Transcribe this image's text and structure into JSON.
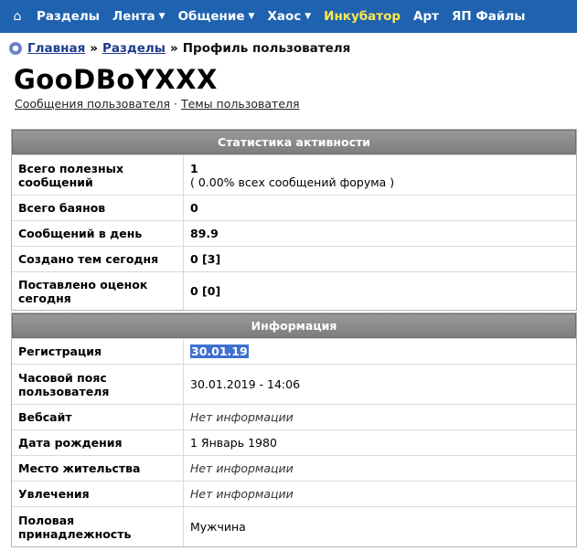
{
  "nav": {
    "home_icon": "home-icon",
    "items": [
      {
        "label": "Разделы",
        "caret": false,
        "highlight": false
      },
      {
        "label": "Лента",
        "caret": true,
        "highlight": false
      },
      {
        "label": "Общение",
        "caret": true,
        "highlight": false
      },
      {
        "label": "Хаос",
        "caret": true,
        "highlight": false
      },
      {
        "label": "Инкубатор",
        "caret": false,
        "highlight": true
      },
      {
        "label": "Арт",
        "caret": false,
        "highlight": false
      },
      {
        "label": "ЯП Файлы",
        "caret": false,
        "highlight": false
      }
    ],
    "caret_glyph": "▼",
    "color": "#1f63b0",
    "highlight_color": "#ffe94b"
  },
  "breadcrumb": {
    "home": "Главная",
    "sep": "»",
    "sections": "Разделы",
    "current": "Профиль пользователя"
  },
  "profile": {
    "username": "GooDBoYXXX",
    "link_messages": "Сообщения пользователя",
    "link_sep": "·",
    "link_topics": "Темы пользователя"
  },
  "activity": {
    "title": "Статистика активности",
    "rows": [
      {
        "label": "Всего полезных сообщений",
        "value": "1",
        "sub": "( 0.00% всех сообщений форума )"
      },
      {
        "label": "Всего баянов",
        "value": "0"
      },
      {
        "label": "Сообщений в день",
        "value": "89.9"
      },
      {
        "label": "Создано тем сегодня",
        "value": "0 [3]"
      },
      {
        "label": "Поставлено оценок сегодня",
        "value": "0 [0]"
      }
    ]
  },
  "info": {
    "title": "Информация",
    "rows": [
      {
        "label": "Регистрация",
        "value": "30.01.19"
      },
      {
        "label": "Часовой пояс пользователя",
        "value": "30.01.2019 - 14:06"
      },
      {
        "label": "Вебсайт",
        "value": "Нет информации"
      },
      {
        "label": "Дата рождения",
        "value": "1 Январь 1980"
      },
      {
        "label": "Место жительства",
        "value": "Нет информации"
      },
      {
        "label": "Увлечения",
        "value": "Нет информации"
      },
      {
        "label": "Половая принадлежность",
        "value": "Мужчина"
      }
    ]
  }
}
